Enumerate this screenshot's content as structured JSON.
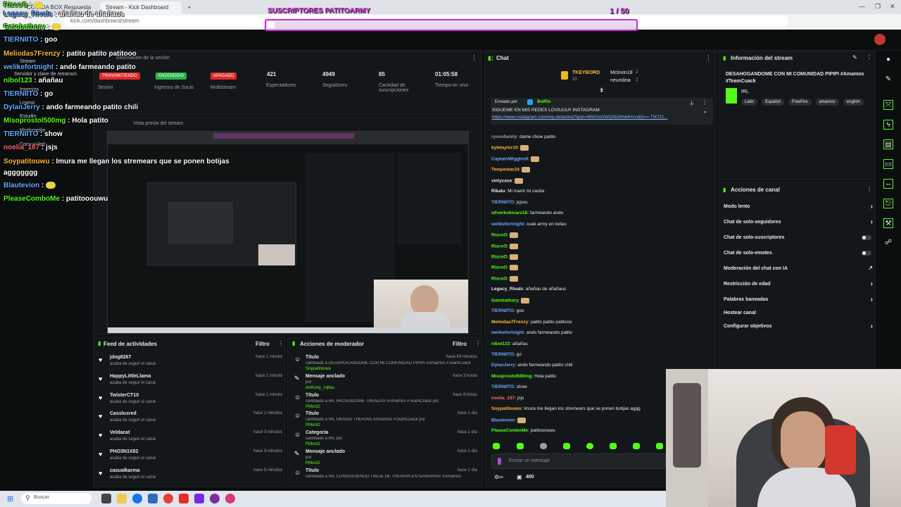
{
  "browser": {
    "tabs": [
      "Stream - Kick Dashboard",
      "COMIDA BOX Respuesta"
    ],
    "url": "kick.com/dashboard/stream",
    "window_controls": [
      "—",
      "❐",
      "✕"
    ]
  },
  "overlay": {
    "subgoal_title": "SUSCRIPTORES PATITOARMY",
    "subgoal_count": "1 / 50",
    "subgoal_progress": 0.02,
    "messages": [
      {
        "user": "RizcoO",
        "text": "",
        "color": "g"
      },
      {
        "user": "Legacy_Rivals",
        "text": "añañau de añañaus",
        "color": "b"
      },
      {
        "user": "Gatobathory",
        "text": "",
        "color": "g"
      },
      {
        "user": "TIERNIITO",
        "text": "goo",
        "color": "b"
      },
      {
        "user": "Meliodas7Frenzy",
        "text": "patito patito patitooo",
        "color": "o"
      },
      {
        "user": "welikefortnight",
        "text": "ando farmeando patito",
        "color": "b"
      },
      {
        "user": "nibol123",
        "text": "añañau",
        "color": "g"
      },
      {
        "user": "TIERNIITO",
        "text": "go",
        "color": "b"
      },
      {
        "user": "DylanJerry",
        "text": "ando farmeando patito chili",
        "color": "b"
      },
      {
        "user": "Misoprostol500mg",
        "text": "Hola patito",
        "color": "g"
      },
      {
        "user": "TIERNIITO",
        "text": "show",
        "color": "b"
      },
      {
        "user": "noelia_187",
        "text": "jsjs",
        "color": "r"
      },
      {
        "user": "Soypatitouwu",
        "text": "Imura me llegan los stremears que se ponen botijas",
        "color": "o"
      },
      {
        "user": "",
        "text": "aggggggg",
        "color": "g"
      },
      {
        "user": "Blautevion",
        "text": "",
        "color": "b"
      },
      {
        "user": "PleaseComboMe",
        "text": "patitooouwu",
        "color": "g"
      }
    ]
  },
  "left_nav": {
    "items": [
      "Stream",
      "Servidor y clave de retransm",
      "Ingresos",
      "Estudio",
      "Logros",
      "Moderación",
      "Comunidad"
    ],
    "info_label": "Información de la sesión",
    "preview_label": "Vista previa del stream"
  },
  "session": {
    "statuses": [
      {
        "pill": "TRANSMITIENDO",
        "label": "Sesión",
        "color": "#e12a2a"
      },
      {
        "pill": "ENCENDIDO",
        "label": "Ingresos de Socio",
        "color": "#2bb24c"
      },
      {
        "pill": "APAGADO",
        "label": "Multistream",
        "color": "#e12a2a"
      }
    ],
    "stats": [
      {
        "value": "421",
        "label": "Espectadores"
      },
      {
        "value": "4949",
        "label": "Seguidores"
      },
      {
        "value": "85",
        "label": "Cantidad de suscripciones"
      },
      {
        "value": "01:05:58",
        "label": "Tiempo en vivo"
      }
    ]
  },
  "activity_feed": {
    "title": "Feed de actividades",
    "filter": "Filtro",
    "items": [
      {
        "name": "jdog8267",
        "desc": "acaba de seguir el canal",
        "time": "hace 1 minuto"
      },
      {
        "name": "HappyLittleLlama",
        "desc": "acaba de seguir el canal",
        "time": "hace 1 minuto"
      },
      {
        "name": "TwisterCT10",
        "desc": "acaba de seguir el canal",
        "time": "hace 1 minuto"
      },
      {
        "name": "Casslusred",
        "desc": "acaba de seguir el canal",
        "time": "hace 2 minutos"
      },
      {
        "name": "Veldacat",
        "desc": "acaba de seguir el canal",
        "time": "hace 3 minutos"
      },
      {
        "name": "PHO3N1X82",
        "desc": "acaba de seguir el canal",
        "time": "hace 3 minutos"
      },
      {
        "name": "casualkarma",
        "desc": "acaba de seguir el canal",
        "time": "hace 5 minutos"
      }
    ]
  },
  "mod_actions": {
    "title": "Acciones de moderador",
    "filter": "Filtro",
    "items": [
      {
        "icon": "person",
        "name": "Título",
        "desc": "cambiado a DESAHOGANDOME CON MI COMUNIDAD PIPIPI #Amamos #TeamCuack",
        "by": "Soypatitouwu",
        "time": "hace 54 minutos"
      },
      {
        "icon": "pin",
        "name": "Mensaje anclado",
        "desc": "por",
        "by": "Anthony_rojitas",
        "time": "hace 3 horas"
      },
      {
        "icon": "person",
        "name": "Título",
        "desc": "cambiado a IRL HACIENDOME TRENZAS #Amamos #TeamCuack por",
        "by": "PMont2",
        "time": "hace 8 horas"
      },
      {
        "icon": "person",
        "name": "Título",
        "desc": "cambiado a IRL SIENDO THERIAN #Amamos #TeamCuack por",
        "by": "PMont2",
        "time": "hace 1 día"
      },
      {
        "icon": "person",
        "name": "Categoría",
        "desc": "cambiado a IRL por",
        "by": "PMont2",
        "time": "hace 1 día"
      },
      {
        "icon": "pin",
        "name": "Mensaje anclado",
        "desc": "por",
        "by": "PMont2",
        "time": "hace 1 día"
      },
      {
        "icon": "person",
        "name": "Título",
        "desc": "cambiado a IRL CONSIGUIENDO TRAJE DE THERIAN EN GAMARRA! #Amamos",
        "by": "",
        "time": "hace 1 día"
      }
    ]
  },
  "chat": {
    "title": "Chat",
    "leaders": [
      {
        "rank": "1",
        "name": "TKEYBORD",
        "value": "10"
      },
      {
        "rank": "2",
        "name": "Mclovin18",
        "value": "2"
      },
      {
        "rank": "3",
        "name": "neurolina",
        "value": "2"
      }
    ],
    "pinned_by_label": "Enviado por",
    "pinned_by": "BotRix",
    "pinned_text": "SIGUEME EN MIS REDES LOVIUUU!! INSTAGRAM",
    "pinned_link": "https://www.instagram.com/mg.delaoliva?igsh=MWVxOWQ0b3hhMHVndQ== TIKTO...",
    "messages": [
      {
        "user": "rynosfamily",
        "text": "dame chow patito",
        "color": "#9aa0a6"
      },
      {
        "user": "kyletaylor10",
        "text": "",
        "color": "#ffb340"
      },
      {
        "user": "CaptainWiggles0",
        "text": "",
        "color": "#6aa7ff"
      },
      {
        "user": "Tempestar24",
        "text": "",
        "color": "#ffb340"
      },
      {
        "user": "vinlycase",
        "text": "",
        "color": "#e8e8e8"
      },
      {
        "user": "Rikalu",
        "text": "Mi mami mi casita",
        "color": "#e8e8e8"
      },
      {
        "user": "TIERNIITO",
        "text": "jsjsxs",
        "color": "#6aa7ff"
      },
      {
        "user": "oliverkokivaro16",
        "text": "farmeando ando",
        "color": "#53fc18"
      },
      {
        "user": "welikefortnight",
        "text": "cuak army en todas",
        "color": "#6aa7ff"
      },
      {
        "user": "RizcoO",
        "text": "",
        "color": "#53fc18"
      },
      {
        "user": "RizcoO",
        "text": "",
        "color": "#53fc18"
      },
      {
        "user": "RizcoO",
        "text": "",
        "color": "#53fc18"
      },
      {
        "user": "RizcoO",
        "text": "",
        "color": "#53fc18"
      },
      {
        "user": "RizcoO",
        "text": "",
        "color": "#53fc18"
      },
      {
        "user": "Legacy_Rivals",
        "text": "añañau de añañaus",
        "color": "#e8e8e8"
      },
      {
        "user": "Gatobathory",
        "text": "",
        "color": "#53fc18"
      },
      {
        "user": "TIERNIITO",
        "text": "goo",
        "color": "#6aa7ff"
      },
      {
        "user": "Meliodas7Frenzy",
        "text": "patito patito patitooo",
        "color": "#ffb340"
      },
      {
        "user": "welikefortnight",
        "text": "ando farmeando patito",
        "color": "#6aa7ff"
      },
      {
        "user": "nibol123",
        "text": "añañau",
        "color": "#53fc18"
      },
      {
        "user": "TIERNIITO",
        "text": "go",
        "color": "#6aa7ff"
      },
      {
        "user": "DylanJerry",
        "text": "ando farmeando patito chili",
        "color": "#6aa7ff"
      },
      {
        "user": "Misoprostol500mg",
        "text": "Hola patito",
        "color": "#53fc18"
      },
      {
        "user": "TIERNIITO",
        "text": "show",
        "color": "#6aa7ff"
      },
      {
        "user": "noelia_187",
        "text": "jsjs",
        "color": "#ff6565"
      },
      {
        "user": "Soypatitouwu",
        "text": "Imura me llegan los stremears que se ponen botijas aggg",
        "color": "#ffb340"
      },
      {
        "user": "Blautevion",
        "text": "",
        "color": "#6aa7ff"
      },
      {
        "user": "PleaseComboMe",
        "text": "patitooouwu",
        "color": "#53fc18"
      }
    ],
    "input_placeholder": "Enviar un mensaje",
    "points": "400"
  },
  "stream_info": {
    "title": "Información del stream",
    "stream_title": "DESAHOGANDOME CON MI COMUNIDAD PIPIPI #Amamos #TeamCuack",
    "category": "IRL",
    "tags": [
      "Latin",
      "Español",
      "FreeFire",
      "amamos",
      "english"
    ]
  },
  "channel_actions": {
    "title": "Acciones de canal",
    "items": [
      {
        "label": "Modo lento",
        "kind": "chevron"
      },
      {
        "label": "Chat de solo-seguidores",
        "kind": "chevron"
      },
      {
        "label": "Chat de solo-suscriptores",
        "kind": "toggle"
      },
      {
        "label": "Chat de solo-emotes",
        "kind": "toggle"
      },
      {
        "label": "Moderación del chat con IA",
        "kind": "ext"
      },
      {
        "label": "Restricción de edad",
        "kind": "chevron"
      },
      {
        "label": "Palabras baneadas",
        "kind": "chevron"
      },
      {
        "label": "Hostear canal",
        "kind": "none"
      },
      {
        "label": "Configurar objetivos",
        "kind": "chevron"
      }
    ]
  },
  "taskbar": {
    "search": "Buscar"
  },
  "colors": {
    "brand": "#53fc18",
    "live": "#e12a2a",
    "overlay_title": "#d12bd6"
  }
}
